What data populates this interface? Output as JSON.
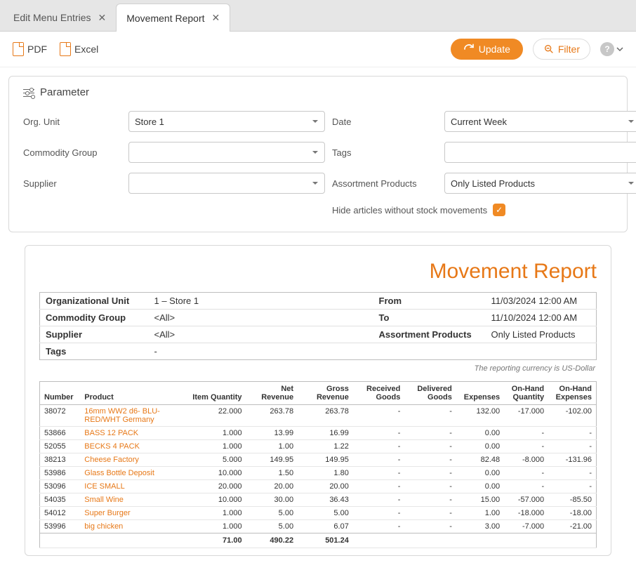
{
  "tabs": [
    {
      "label": "Edit Menu Entries",
      "active": false
    },
    {
      "label": "Movement Report",
      "active": true
    }
  ],
  "toolbar": {
    "pdf": "PDF",
    "excel": "Excel",
    "update": "Update",
    "filter": "Filter"
  },
  "panel": {
    "title": "Parameter",
    "labels": {
      "orgunit": "Org. Unit",
      "commodity": "Commodity Group",
      "supplier": "Supplier",
      "date": "Date",
      "tags": "Tags",
      "assortment": "Assortment Products",
      "hide": "Hide articles without stock movements"
    },
    "values": {
      "orgunit": "Store 1",
      "commodity": "",
      "supplier": "",
      "date": "Current Week",
      "tags": "",
      "assortment": "Only Listed Products",
      "hideChecked": true
    }
  },
  "report": {
    "title": "Movement Report",
    "meta": {
      "orgunit_label": "Organizational Unit",
      "orgunit_value": "1 – Store 1",
      "commodity_label": "Commodity Group",
      "commodity_value": "<All>",
      "supplier_label": "Supplier",
      "supplier_value": "<All>",
      "tags_label": "Tags",
      "tags_value": "-",
      "from_label": "From",
      "from_value": "11/03/2024 12:00 AM",
      "to_label": "To",
      "to_value": "11/10/2024 12:00 AM",
      "assort_label": "Assortment Products",
      "assort_value": "Only Listed Products"
    },
    "currency_note": "The reporting currency is US-Dollar",
    "columns": {
      "number": "Number",
      "product": "Product",
      "item_qty": "Item Quantity",
      "net_rev": "Net Revenue",
      "gross_rev": "Gross Revenue",
      "received": "Received Goods",
      "delivered": "Delivered Goods",
      "expenses": "Expenses",
      "onhand_qty": "On-Hand Quantity",
      "onhand_exp": "On-Hand Expenses"
    },
    "rows": [
      {
        "number": "38072",
        "product": "16mm WW2 d6- BLU-RED/WHT Germany",
        "qty": "22.000",
        "nr": "263.78",
        "gr": "263.78",
        "rg": "-",
        "dg": "-",
        "exp": "132.00",
        "ohq": "-17.000",
        "ohe": "-102.00"
      },
      {
        "number": "53866",
        "product": "BASS 12 PACK",
        "qty": "1.000",
        "nr": "13.99",
        "gr": "16.99",
        "rg": "-",
        "dg": "-",
        "exp": "0.00",
        "ohq": "-",
        "ohe": "-"
      },
      {
        "number": "52055",
        "product": "BECKS 4 PACK",
        "qty": "1.000",
        "nr": "1.00",
        "gr": "1.22",
        "rg": "-",
        "dg": "-",
        "exp": "0.00",
        "ohq": "-",
        "ohe": "-"
      },
      {
        "number": "38213",
        "product": "Cheese Factory",
        "qty": "5.000",
        "nr": "149.95",
        "gr": "149.95",
        "rg": "-",
        "dg": "-",
        "exp": "82.48",
        "ohq": "-8.000",
        "ohe": "-131.96"
      },
      {
        "number": "53986",
        "product": "Glass Bottle Deposit",
        "qty": "10.000",
        "nr": "1.50",
        "gr": "1.80",
        "rg": "-",
        "dg": "-",
        "exp": "0.00",
        "ohq": "-",
        "ohe": "-"
      },
      {
        "number": "53096",
        "product": "ICE SMALL",
        "qty": "20.000",
        "nr": "20.00",
        "gr": "20.00",
        "rg": "-",
        "dg": "-",
        "exp": "0.00",
        "ohq": "-",
        "ohe": "-"
      },
      {
        "number": "54035",
        "product": "Small Wine",
        "qty": "10.000",
        "nr": "30.00",
        "gr": "36.43",
        "rg": "-",
        "dg": "-",
        "exp": "15.00",
        "ohq": "-57.000",
        "ohe": "-85.50"
      },
      {
        "number": "54012",
        "product": "Super Burger",
        "qty": "1.000",
        "nr": "5.00",
        "gr": "5.00",
        "rg": "-",
        "dg": "-",
        "exp": "1.00",
        "ohq": "-18.000",
        "ohe": "-18.00"
      },
      {
        "number": "53996",
        "product": "big chicken",
        "qty": "1.000",
        "nr": "5.00",
        "gr": "6.07",
        "rg": "-",
        "dg": "-",
        "exp": "3.00",
        "ohq": "-7.000",
        "ohe": "-21.00"
      }
    ],
    "totals": {
      "qty": "71.00",
      "nr": "490.22",
      "gr": "501.24"
    }
  }
}
